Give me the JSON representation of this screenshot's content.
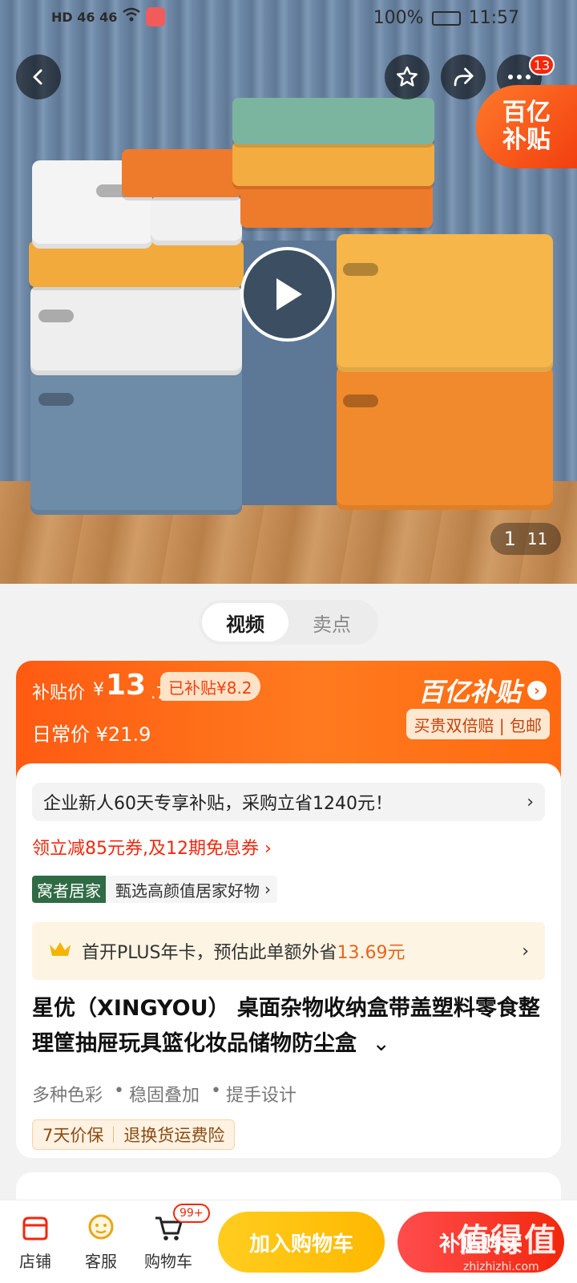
{
  "status_bar": {
    "left": "HD 46 46",
    "battery": "100%",
    "time": "11:57"
  },
  "header": {
    "more_badge": "13",
    "subsidy_corner_line1": "百亿",
    "subsidy_corner_line2": "补贴"
  },
  "gallery": {
    "current": "1",
    "total": "11"
  },
  "media_tabs": [
    {
      "label": "视频",
      "active": true
    },
    {
      "label": "卖点",
      "active": false
    }
  ],
  "price": {
    "subsidy_label": "补贴价",
    "currency": "¥",
    "subsidy_int": "13",
    "subsidy_dec": ".7",
    "saved_tag": "已补贴¥8.2",
    "daily_label": "日常价",
    "daily_price": "¥21.9",
    "brand": "百亿补贴",
    "brand_arrow": "›",
    "guarantee": "买贵双倍赔 | 包邮"
  },
  "info": {
    "enterprise_promo": "企业新人60天专享补贴，采购立省1240元！",
    "coupon": "领立减85元券,及12期免息券 ›",
    "store_tag": "窝者居家",
    "store_desc": "甄选高颜值居家好物",
    "plus_text_prefix": "首开PLUS年卡，预估此单额外省",
    "plus_amount": "13.69",
    "plus_suffix": "元",
    "title": "星优（XINGYOU） 桌面杂物收纳盒带盖塑料零食整理筐抽屉玩具篮化妆品储物防尘盒",
    "expand": "⌄",
    "features": [
      "多种色彩",
      "稳固叠加",
      "提手设计"
    ],
    "service_badges": [
      "7天价保",
      "退换货运费险"
    ]
  },
  "bottom_bar": {
    "items": [
      {
        "label": "店铺"
      },
      {
        "label": "客服"
      },
      {
        "label": "购物车",
        "badge": "99+"
      }
    ],
    "add_to_cart": "加入购物车",
    "buy_now": "补贴购买",
    "watermark": "值得值",
    "watermark_url": "zhizhizhi.com"
  },
  "colors": {
    "accent": "#ff5b12",
    "subsidy_red": "#f2270c",
    "cart_yellow": "#ffc012"
  }
}
